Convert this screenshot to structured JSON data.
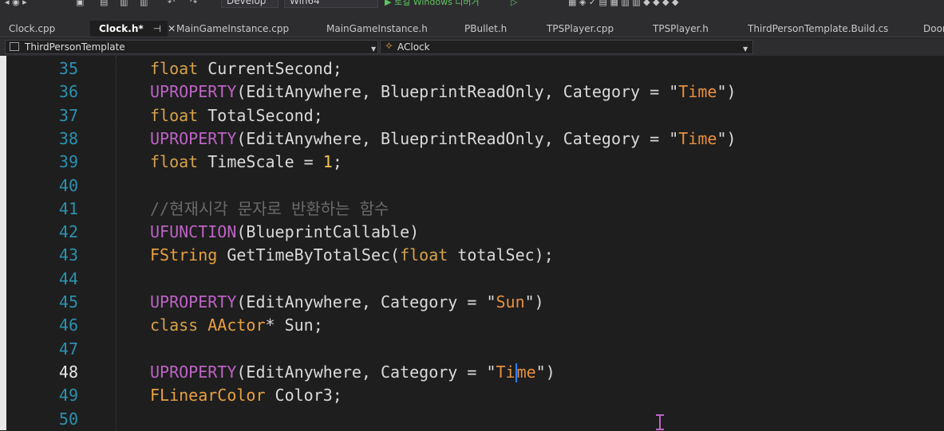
{
  "toolbar": {
    "config_combo": "Develop",
    "platform_combo": "Win64",
    "run_label": "▶ 로컬 Windows 디버거"
  },
  "tabs": [
    {
      "label": "Clock.cpp"
    },
    {
      "label": "Clock.h*",
      "active": true
    },
    {
      "label": "MainGameInstance.cpp"
    },
    {
      "label": "MainGameInstance.h"
    },
    {
      "label": "PBullet.h"
    },
    {
      "label": "TPSPlayer.cpp"
    },
    {
      "label": "TPSPlayer.h"
    },
    {
      "label": "ThirdPersonTemplate.Build.cs"
    },
    {
      "label": "Door"
    }
  ],
  "nav": {
    "project": "ThirdPersonTemplate",
    "class": "AClock"
  },
  "editor": {
    "current_line": 48,
    "lines": [
      {
        "n": "35",
        "tokens": [
          [
            "kw",
            "float"
          ],
          [
            "id",
            " CurrentSecond;"
          ]
        ]
      },
      {
        "n": "36",
        "tokens": [
          [
            "macro",
            "UPROPERTY"
          ],
          [
            "id",
            "(EditAnywhere, BlueprintReadOnly, Category = \""
          ],
          [
            "str",
            "Time"
          ],
          [
            "id",
            "\")"
          ]
        ]
      },
      {
        "n": "37",
        "tokens": [
          [
            "kw",
            "float"
          ],
          [
            "id",
            " TotalSecond;"
          ]
        ]
      },
      {
        "n": "38",
        "tokens": [
          [
            "macro",
            "UPROPERTY"
          ],
          [
            "id",
            "(EditAnywhere, BlueprintReadOnly, Category = \""
          ],
          [
            "str",
            "Time"
          ],
          [
            "id",
            "\")"
          ]
        ]
      },
      {
        "n": "39",
        "tokens": [
          [
            "kw",
            "float"
          ],
          [
            "id",
            " TimeScale = "
          ],
          [
            "num",
            "1"
          ],
          [
            "id",
            ";"
          ]
        ]
      },
      {
        "n": "40",
        "tokens": []
      },
      {
        "n": "41",
        "tokens": [
          [
            "cmt",
            "//현재시각 문자로 반환하는 함수"
          ]
        ]
      },
      {
        "n": "42",
        "tokens": [
          [
            "macro",
            "UFUNCTION"
          ],
          [
            "id",
            "(BlueprintCallable)"
          ]
        ]
      },
      {
        "n": "43",
        "tokens": [
          [
            "type",
            "FString"
          ],
          [
            "id",
            " GetTimeByTotalSec("
          ],
          [
            "kw",
            "float"
          ],
          [
            "id",
            " totalSec);"
          ]
        ]
      },
      {
        "n": "44",
        "tokens": []
      },
      {
        "n": "45",
        "tokens": [
          [
            "macro",
            "UPROPERTY"
          ],
          [
            "id",
            "(EditAnywhere, Category = \""
          ],
          [
            "str",
            "Sun"
          ],
          [
            "id",
            "\")"
          ]
        ]
      },
      {
        "n": "46",
        "tokens": [
          [
            "kw",
            "class"
          ],
          [
            "id",
            " "
          ],
          [
            "type",
            "AActor"
          ],
          [
            "id",
            "* Sun;"
          ]
        ]
      },
      {
        "n": "47",
        "tokens": []
      },
      {
        "n": "48",
        "tokens": [
          [
            "macro",
            "UPROPERTY"
          ],
          [
            "id",
            "(EditAnywhere, Category = \""
          ],
          [
            "str",
            "Ti"
          ],
          [
            "cursor",
            ""
          ],
          [
            "str",
            "me"
          ],
          [
            "id",
            "\")"
          ]
        ]
      },
      {
        "n": "49",
        "tokens": [
          [
            "type",
            "FLinearColor"
          ],
          [
            "id",
            " Color3;"
          ]
        ]
      },
      {
        "n": "50",
        "tokens": []
      }
    ]
  }
}
